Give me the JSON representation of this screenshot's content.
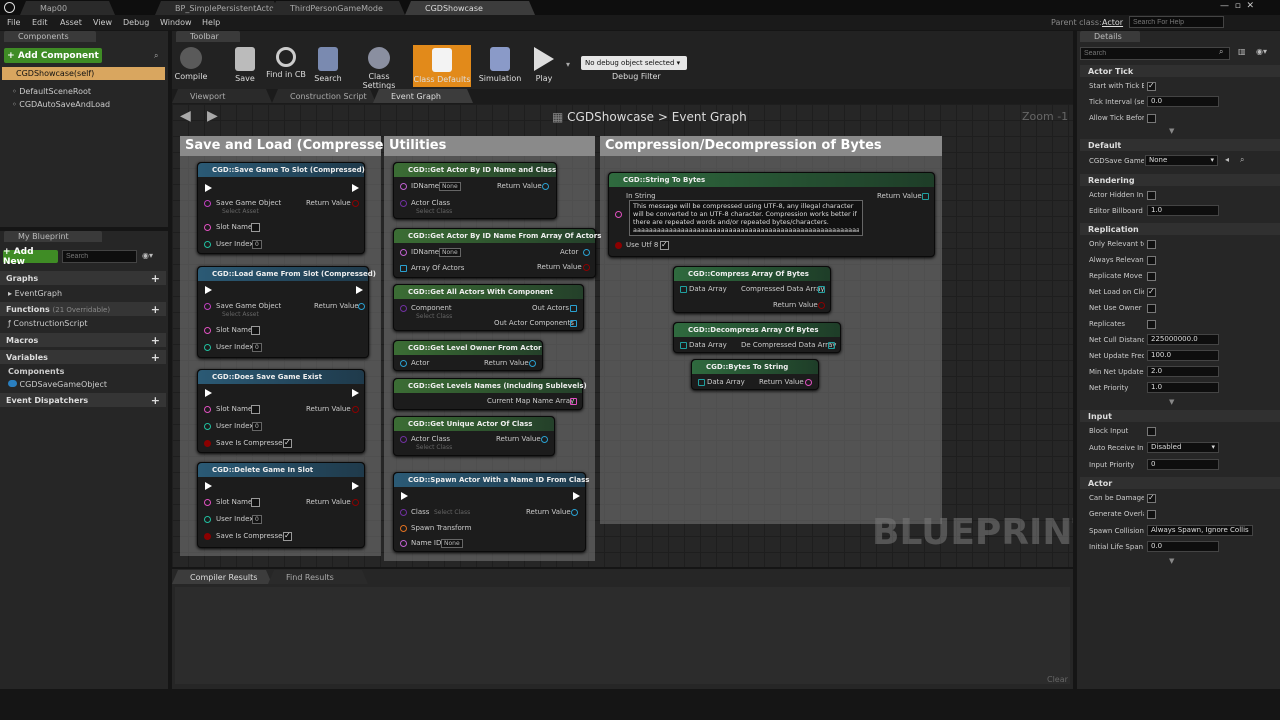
{
  "tabs": [
    "Map00",
    "BP_SimplePersistentActor",
    "ThirdPersonGameMode",
    "CGDShowcase"
  ],
  "parent_class_label": "Parent class:",
  "parent_class_value": "Actor",
  "search_help_placeholder": "Search For Help",
  "menu": [
    "File",
    "Edit",
    "Asset",
    "View",
    "Debug",
    "Window",
    "Help"
  ],
  "components": {
    "header": "Components",
    "add_button": "+ Add Component",
    "self": "CGDShowcase(self)",
    "items": [
      "DefaultSceneRoot",
      "CGDAutoSaveAndLoad"
    ]
  },
  "my_blueprint": {
    "header": "My Blueprint",
    "add_new": "+ Add New",
    "search_placeholder": "Search",
    "graphs": "Graphs",
    "event_graph": "EventGraph",
    "functions": "Functions",
    "functions_overridable": "(21 Overridable)",
    "construction_script": "ConstructionScript",
    "macros": "Macros",
    "variables": "Variables",
    "components": "Components",
    "component_var": "CGDSaveGameObject",
    "event_dispatchers": "Event Dispatchers"
  },
  "toolbar": {
    "header": "Toolbar",
    "buttons": [
      "Compile",
      "Save",
      "Find in CB",
      "Search",
      "Class Settings",
      "Class Defaults",
      "Simulation",
      "Play"
    ],
    "debug_select": "No debug object selected",
    "debug_filter": "Debug Filter"
  },
  "graph_tabs": [
    "Viewport",
    "Construction Script",
    "Event Graph"
  ],
  "breadcrumb": {
    "root": "CGDShowcase",
    "sep": ">",
    "current": "Event Graph"
  },
  "zoom": "Zoom -1",
  "watermark": "BLUEPRINT",
  "comments": [
    "Save and Load (Compressed)",
    "Utilities",
    "Compression/Decompression of Bytes"
  ],
  "nodes": {
    "save_game": {
      "title": "CGD::Save Game To Slot (Compressed)",
      "p1": "Save Game Object",
      "p1sub": "Select Asset",
      "p2": "Slot Name",
      "p3": "User Index",
      "p3v": "0",
      "out": "Return Value"
    },
    "load_game": {
      "title": "CGD::Load Game From Slot (Compressed)",
      "p1": "Save Game Object",
      "p1sub": "Select Asset",
      "p2": "Slot Name",
      "p3": "User Index",
      "p3v": "0",
      "out": "Return Value"
    },
    "does_exist": {
      "title": "CGD::Does Save Game Exist",
      "p1": "Slot Name",
      "p2": "User Index",
      "p2v": "0",
      "p3": "Save Is Compressed",
      "out": "Return Value"
    },
    "delete_game": {
      "title": "CGD::Delete Game In Slot",
      "p1": "Slot Name",
      "p2": "User Index",
      "p2v": "0",
      "p3": "Save Is Compressed",
      "out": "Return Value"
    },
    "get_actor_id_class": {
      "title": "CGD::Get Actor By ID Name and Class",
      "p1": "IDName",
      "p1v": "None",
      "p2": "Actor Class",
      "p2sub": "Select Class",
      "out": "Return Value"
    },
    "get_actor_id_array": {
      "title": "CGD::Get Actor By ID Name From Array Of Actors",
      "p1": "IDName",
      "p1v": "None",
      "p2": "Array Of Actors",
      "out1": "Actor",
      "out2": "Return Value"
    },
    "get_all_actors": {
      "title": "CGD::Get All Actors With Component",
      "p1": "Component",
      "p1sub": "Select Class",
      "out1": "Out Actors",
      "out2": "Out Actor Components"
    },
    "get_level_owner": {
      "title": "CGD::Get Level Owner From Actor",
      "p1": "Actor",
      "out": "Return Value"
    },
    "get_levels_names": {
      "title": "CGD::Get Levels Names (Including Sublevels)",
      "out": "Current Map Name Array"
    },
    "get_unique_actor": {
      "title": "CGD::Get Unique Actor Of Class",
      "p1": "Actor Class",
      "p1sub": "Select Class",
      "out": "Return Value"
    },
    "spawn_actor": {
      "title": "CGD::Spawn Actor With a Name ID From Class",
      "p1": "Class",
      "p1sub": "Select Class",
      "p2": "Spawn Transform",
      "p3": "Name ID",
      "p3v": "None",
      "out": "Return Value"
    },
    "string_to_bytes": {
      "title": "CGD::String To Bytes",
      "p1": "In String",
      "text": "This message will be compressed using UTF-8, any illegal character will be converted to an UTF-8 character. Compression works better if there are repeated words and/or repeated bytes/characters.",
      "text2": "aaaaaaaaaaaaaaaaaaaaaaaaaaaaaaaaaaaaaaaaaaaaaaaaaaaaaaaaaaaaa",
      "p2": "Use Utf 8",
      "out": "Return Value"
    },
    "compress": {
      "title": "CGD::Compress Array Of Bytes",
      "p1": "Data Array",
      "out1": "Compressed Data Array",
      "out2": "Return Value"
    },
    "decompress": {
      "title": "CGD::Decompress Array Of Bytes",
      "p1": "Data Array",
      "out1": "De Compressed Data Array"
    },
    "bytes_to_string": {
      "title": "CGD::Bytes To String",
      "p1": "Data Array",
      "out": "Return Value"
    }
  },
  "bottom_tabs": [
    "Compiler Results",
    "Find Results"
  ],
  "clear": "Clear",
  "details": {
    "header": "Details",
    "search_placeholder": "Search",
    "actor_tick": "Actor Tick",
    "start_with_tick": "Start with Tick E",
    "tick_interval": "Tick Interval (se",
    "tick_interval_v": "0.0",
    "allow_tick": "Allow Tick Befor",
    "default": "Default",
    "cgdsave": "CGDSave Game",
    "cgdsave_v": "None",
    "rendering": "Rendering",
    "actor_hidden": "Actor Hidden In",
    "editor_billboard": "Editor Billboard",
    "editor_billboard_v": "1.0",
    "replication": "Replication",
    "only_relevant": "Only Relevant tc",
    "always_relevant": "Always Relevan",
    "replicate_movement": "Replicate Move",
    "net_load": "Net Load on Clie",
    "net_use_owner": "Net Use Owner I",
    "replicates": "Replicates",
    "net_cull": "Net Cull Distanc",
    "net_cull_v": "225000000.0",
    "net_update_freq": "Net Update Freq",
    "net_update_freq_v": "100.0",
    "min_net_update": "Min Net Update",
    "min_net_update_v": "2.0",
    "net_priority": "Net Priority",
    "net_priority_v": "1.0",
    "input": "Input",
    "block_input": "Block Input",
    "auto_receive": "Auto Receive Inp",
    "auto_receive_v": "Disabled",
    "input_priority": "Input Priority",
    "input_priority_v": "0",
    "actor": "Actor",
    "can_be_damaged": "Can be Damage",
    "generate_overlap": "Generate Overla",
    "spawn_collision": "Spawn Collision",
    "spawn_collision_v": "Always Spawn, Ignore Collis",
    "initial_life": "Initial Life Span",
    "initial_life_v": "0.0"
  }
}
